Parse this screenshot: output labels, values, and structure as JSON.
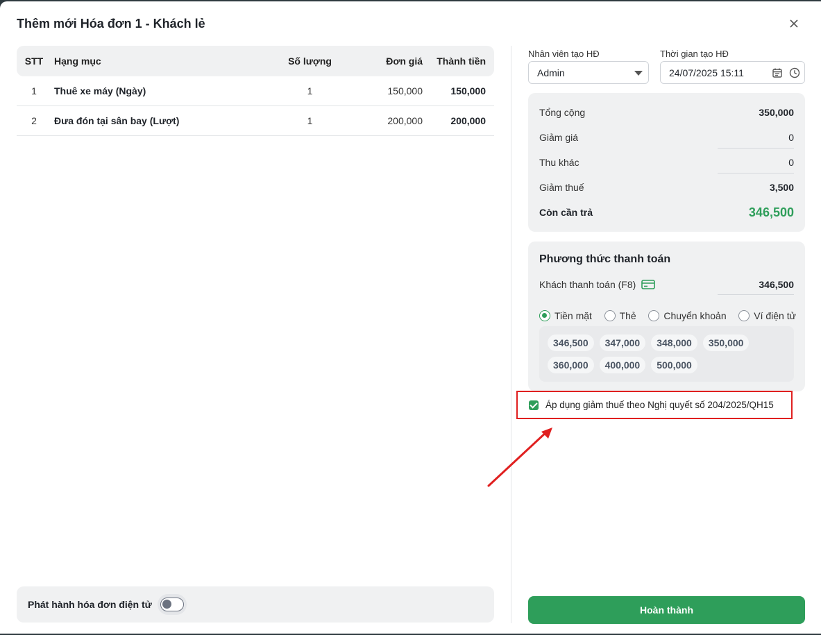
{
  "modal": {
    "title": "Thêm mới Hóa đơn 1 - Khách lẻ"
  },
  "table": {
    "headers": {
      "stt": "STT",
      "name": "Hạng mục",
      "qty": "Số lượng",
      "price": "Đơn giá",
      "total": "Thành tiền"
    },
    "rows": [
      {
        "stt": "1",
        "name": "Thuê xe máy (Ngày)",
        "qty": "1",
        "price": "150,000",
        "total": "150,000"
      },
      {
        "stt": "2",
        "name": "Đưa đón tại sân bay (Lượt)",
        "qty": "1",
        "price": "200,000",
        "total": "200,000"
      }
    ]
  },
  "einvoice": {
    "label": "Phát hành hóa đơn điện tử",
    "enabled": false
  },
  "creator": {
    "label": "Nhân viên tạo HĐ",
    "value": "Admin"
  },
  "created_time": {
    "label": "Thời gian tạo HĐ",
    "value": "24/07/2025 15:11"
  },
  "summary": {
    "total": {
      "label": "Tổng cộng",
      "value": "350,000"
    },
    "discount": {
      "label": "Giảm giá",
      "value": "0"
    },
    "other": {
      "label": "Thu khác",
      "value": "0"
    },
    "tax_reduction": {
      "label": "Giảm thuế",
      "value": "3,500"
    },
    "remaining": {
      "label": "Còn cần trả",
      "value": "346,500"
    }
  },
  "payment": {
    "title": "Phương thức thanh toán",
    "customer_pay_label": "Khách thanh toán (F8)",
    "customer_pay_value": "346,500",
    "methods": [
      {
        "label": "Tiền mặt",
        "selected": true
      },
      {
        "label": "Thẻ",
        "selected": false
      },
      {
        "label": "Chuyển khoản",
        "selected": false
      },
      {
        "label": "Ví điện tử",
        "selected": false
      }
    ],
    "quick_amounts": [
      "346,500",
      "347,000",
      "348,000",
      "350,000",
      "360,000",
      "400,000",
      "500,000"
    ]
  },
  "tax_policy": {
    "label": "Áp dụng giảm thuế theo Nghị quyết số 204/2025/QH15",
    "checked": true
  },
  "actions": {
    "done_label": "Hoàn thành"
  },
  "colors": {
    "accent": "#2e9e5a",
    "highlight_border": "#e02020"
  }
}
